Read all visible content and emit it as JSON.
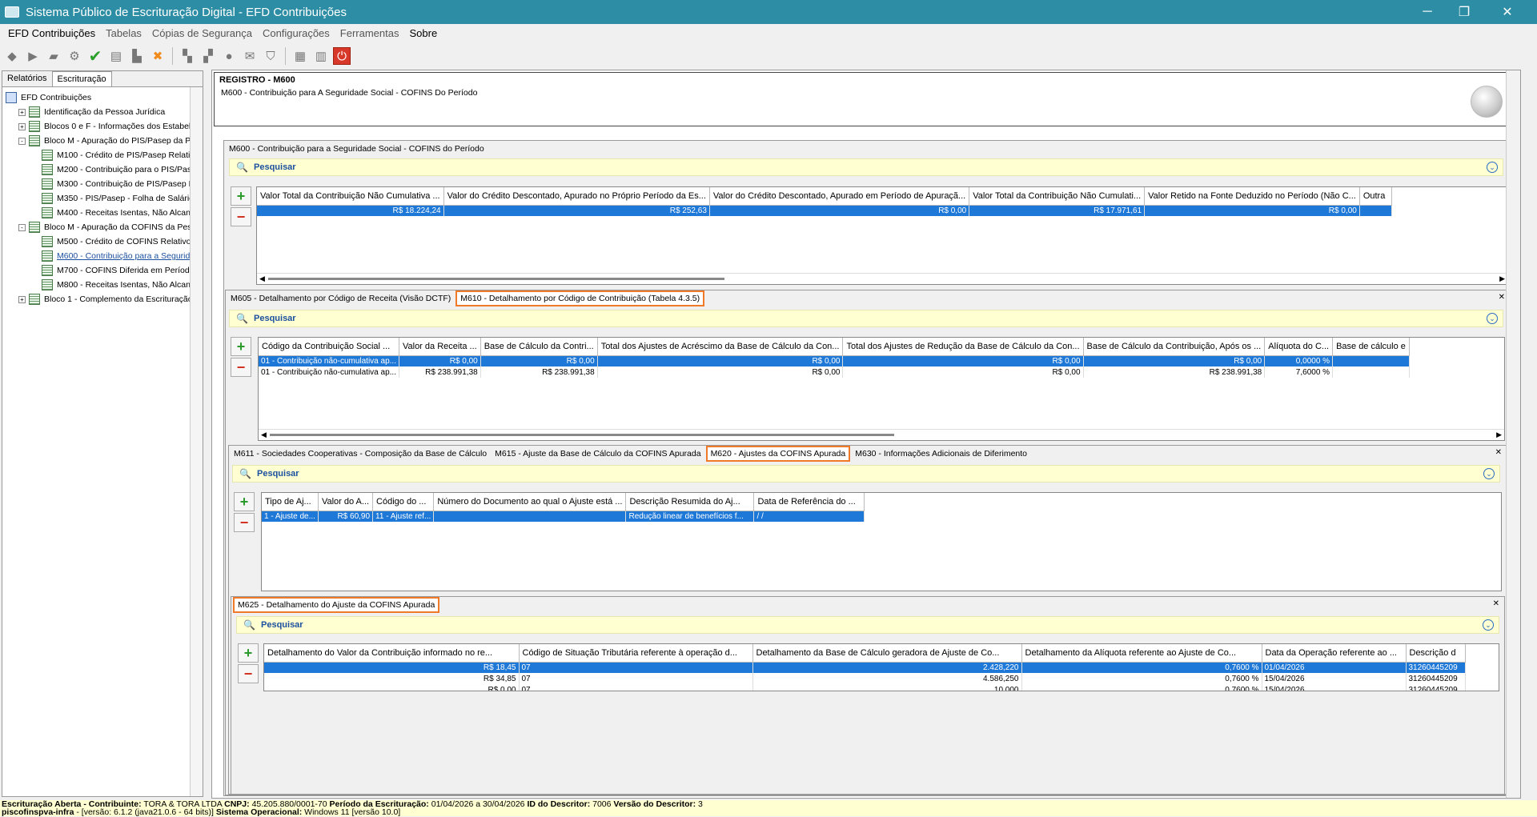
{
  "window": {
    "title": "Sistema Público de Escrituração Digital - EFD Contribuições",
    "minimize": "─",
    "maximize": "❐",
    "close": "✕"
  },
  "menu": [
    "EFD Contribuições",
    "Tabelas",
    "Cópias de Segurança",
    "Configurações",
    "Ferramentas",
    "Sobre"
  ],
  "left": {
    "tabs": [
      "Relatórios",
      "Escrituração"
    ],
    "tree": [
      {
        "label": "EFD Contribuições",
        "level": 0,
        "exp": "",
        "icon": "blue"
      },
      {
        "label": "Identificação da Pessoa Jurídica",
        "level": 1,
        "exp": "+"
      },
      {
        "label": "Blocos 0 e F - Informações dos Estabel",
        "level": 1,
        "exp": "+"
      },
      {
        "label": "Bloco M - Apuração do PIS/Pasep da Pe",
        "level": 1,
        "exp": "-"
      },
      {
        "label": "M100 - Crédito de PIS/Pasep Relativ",
        "level": 2,
        "exp": ""
      },
      {
        "label": "M200 - Contribuição para o PIS/Pase",
        "level": 2,
        "exp": ""
      },
      {
        "label": "M300 - Contribuição de PIS/Pasep D",
        "level": 2,
        "exp": ""
      },
      {
        "label": "M350 - PIS/Pasep - Folha de Salário",
        "level": 2,
        "exp": ""
      },
      {
        "label": "M400 - Receitas Isentas, Não Alcan",
        "level": 2,
        "exp": ""
      },
      {
        "label": "Bloco M - Apuração da COFINS da Pess",
        "level": 1,
        "exp": "-"
      },
      {
        "label": "M500 - Crédito de COFINS Relativo a",
        "level": 2,
        "exp": ""
      },
      {
        "label": "M600 - Contribuição para a Segurida",
        "level": 2,
        "exp": "",
        "sel": true
      },
      {
        "label": "M700 - COFINS Diferida em Períodos",
        "level": 2,
        "exp": ""
      },
      {
        "label": "M800 - Receitas Isentas, Não Alcan",
        "level": 2,
        "exp": ""
      },
      {
        "label": "Bloco 1 - Complemento da Escrituração",
        "level": 1,
        "exp": "+"
      }
    ]
  },
  "header": {
    "title": "REGISTRO - M600",
    "subtitle": "M600 - Contribuição para A Seguridade Social - COFINS Do Período"
  },
  "search_label": "Pesquisar",
  "p1": {
    "tab": "M600 - Contribuição para a Seguridade Social - COFINS do Período",
    "cols": [
      "Valor Total da Contribuição Não Cumulativa ...",
      "Valor do Crédito Descontado, Apurado no Próprio Período da Es...",
      "Valor do Crédito Descontado, Apurado em Período de Apuraçã...",
      "Valor Total da Contribuição Não Cumulati...",
      "Valor Retido na Fonte Deduzido no Período (Não C...",
      "Outra"
    ],
    "rows": [
      [
        "R$ 18.224,24",
        "R$ 252,63",
        "R$ 0,00",
        "R$ 17.971,61",
        "R$ 0,00",
        ""
      ]
    ]
  },
  "p2": {
    "tabs": [
      "M605 - Detalhamento por Código de Receita (Visão DCTF)",
      "M610 - Detalhamento por Código de Contribuição (Tabela 4.3.5)"
    ],
    "cols": [
      "Código da Contribuição Social ...",
      "Valor da Receita ...",
      "Base de Cálculo da Contri...",
      "Total dos Ajustes de Acréscimo da Base de Cálculo da Con...",
      "Total dos Ajustes de Redução da Base de Cálculo da Con...",
      "Base de Cálculo da Contribuição, Após os ...",
      "Alíquota do C...",
      "Base de cálculo e"
    ],
    "rows": [
      [
        "01 - Contribuição não-cumulativa ap...",
        "R$ 0,00",
        "R$ 0,00",
        "R$ 0,00",
        "R$ 0,00",
        "R$ 0,00",
        "0,0000 %",
        ""
      ],
      [
        "01 - Contribuição não-cumulativa ap...",
        "R$ 238.991,38",
        "R$ 238.991,38",
        "R$ 0,00",
        "R$ 0,00",
        "R$ 238.991,38",
        "7,6000 %",
        ""
      ]
    ]
  },
  "p3": {
    "tabs": [
      "M611 - Sociedades Cooperativas - Composição da Base de Cálculo",
      "M615 - Ajuste da Base de Cálculo da COFINS Apurada",
      "M620 - Ajustes da COFINS Apurada",
      "M630 - Informações Adicionais de Diferimento"
    ],
    "cols": [
      "Tipo de Aj...",
      "Valor do A...",
      "Código do ...",
      "Número do Documento ao qual o Ajuste está ...",
      "Descrição Resumida do Aj...",
      "Data de Referência do ..."
    ],
    "rows": [
      [
        "1 - Ajuste de...",
        "R$ 60,90",
        "11 - Ajuste ref...",
        "",
        "Redução linear de benefícios f...",
        "/ /"
      ]
    ]
  },
  "p4": {
    "tab": "M625 - Detalhamento do Ajuste da COFINS Apurada",
    "cols": [
      "Detalhamento do Valor da Contribuição informado no re...",
      "Código de Situação Tributária referente à operação d...",
      "Detalhamento da Base de Cálculo geradora de Ajuste de Co...",
      "Detalhamento da Alíquota referente ao Ajuste de Co...",
      "Data da Operação referente ao ...",
      "Descrição d"
    ],
    "rows": [
      [
        "R$ 18,45",
        "07",
        "2.428,220",
        "0,7600 %",
        "01/04/2026",
        "31260445209"
      ],
      [
        "R$ 34,85",
        "07",
        "4.586,250",
        "0,7600 %",
        "15/04/2026",
        "31260445209"
      ],
      [
        "R$ 0,00",
        "07",
        "10.000",
        "0,7600 %",
        "15/04/2026",
        "31260445209"
      ]
    ]
  },
  "status": {
    "line1_a": "Escrituração Aberta - Contribuinte:",
    "line1_b": "TORA & TORA LTDA",
    "line1_c": "CNPJ:",
    "line1_d": "45.205.880/0001-70",
    "line1_e": "Período da Escrituração:",
    "line1_f": "01/04/2026 a 30/04/2026",
    "line1_g": "ID do Descritor:",
    "line1_h": "7006",
    "line1_i": "Versão do Descritor:",
    "line1_j": "3",
    "line2_a": "piscofinspva-infra",
    "line2_b": "- [versão: 6.1.2 (java21.0.6 - 64 bits)]",
    "line2_c": "Sistema Operacional:",
    "line2_d": "Windows 11 [versão 10.0]"
  }
}
